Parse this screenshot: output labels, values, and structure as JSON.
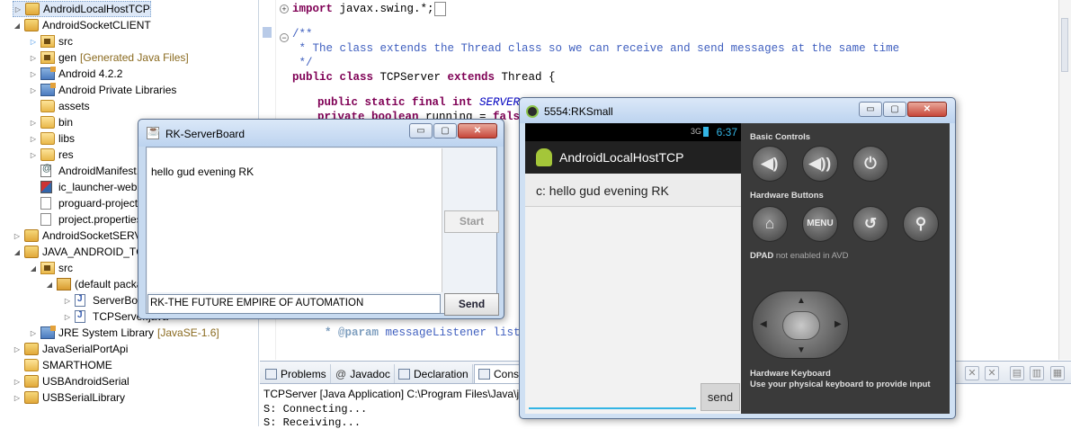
{
  "explorer": {
    "rows": [
      {
        "label": "AndroidLocalHostTCP",
        "decor": ""
      },
      {
        "label": "AndroidSocketCLIENT",
        "decor": ""
      },
      {
        "label": "src",
        "decor": ""
      },
      {
        "label": "gen",
        "decor": "[Generated Java Files]"
      },
      {
        "label": "Android 4.2.2",
        "decor": ""
      },
      {
        "label": "Android Private Libraries",
        "decor": ""
      },
      {
        "label": "assets",
        "decor": ""
      },
      {
        "label": "bin",
        "decor": ""
      },
      {
        "label": "libs",
        "decor": ""
      },
      {
        "label": "res",
        "decor": ""
      },
      {
        "label": "AndroidManifest.xml",
        "decor": ""
      },
      {
        "label": "ic_launcher-web.png",
        "decor": ""
      },
      {
        "label": "proguard-project.txt",
        "decor": ""
      },
      {
        "label": "project.properties",
        "decor": ""
      },
      {
        "label": "AndroidSocketSERVER",
        "decor": ""
      },
      {
        "label": "JAVA_ANDROID_TCP",
        "decor": ""
      },
      {
        "label": "src",
        "decor": ""
      },
      {
        "label": "(default package)",
        "decor": ""
      },
      {
        "label": "ServerBoard.java",
        "decor": ""
      },
      {
        "label": "TCPServer.java",
        "decor": ""
      },
      {
        "label": "JRE System Library",
        "decor": "[JavaSE-1.6]"
      },
      {
        "label": "JavaSerialPortApi",
        "decor": ""
      },
      {
        "label": "SMARTHOME",
        "decor": ""
      },
      {
        "label": "USBAndroidSerial",
        "decor": ""
      },
      {
        "label": "USBSerialLibrary",
        "decor": ""
      }
    ]
  },
  "editor": {
    "import_kw": "import",
    "import_rest": " javax.swing.*;",
    "import_box": " ",
    "doc_open": "/**",
    "doc_line": " * The class extends the Thread class so we can receive and send messages at the same time",
    "doc_close": " */",
    "class_kw1": "public class",
    "class_name": " TCPServer ",
    "class_kw2": "extends",
    "class_rest": " Thread {",
    "field1_kw": "public static final int",
    "field1_name": " SERVERPO",
    "field2_kw": "private boolean",
    "field2_rest": " running = ",
    "field2_val": "false",
    "field2_end": ";",
    "param_tag": "* @param",
    "param_rest": " messageListener listen"
  },
  "bottom": {
    "tabs": [
      "Problems",
      "Javadoc",
      "Declaration",
      "Cons"
    ],
    "console_title": "TCPServer [Java Application] C:\\Program Files\\Java\\jre",
    "console_lines": [
      "S: Connecting...",
      "S: Receiving..."
    ]
  },
  "swing": {
    "title": "RK-ServerBoard",
    "message": "hello gud evening RK",
    "start_label": "Start",
    "input_value": "RK-THE FUTURE EMPIRE OF AUTOMATION",
    "send_label": "Send",
    "min_glyph": "▭",
    "max_glyph": "▢",
    "close_glyph": "✕"
  },
  "emulator": {
    "title": "5554:RKSmall",
    "status_signal": "3G",
    "status_time": "6:37",
    "app_title": "AndroidLocalHostTCP",
    "received_message": "c: hello gud evening RK",
    "send_label": "send",
    "basic_controls": "Basic Controls",
    "hardware_buttons": "Hardware Buttons",
    "dpad_label": "DPAD",
    "dpad_note": "not enabled in AVD",
    "keyboard_label": "Hardware Keyboard",
    "keyboard_note": "Use your physical keyboard to provide input",
    "menu_label": "MENU",
    "vol_down_glyph": "◀)",
    "vol_up_glyph": "◀))",
    "power_glyph": "⏻",
    "home_glyph": "⌂",
    "back_glyph": "↺",
    "search_glyph": "⚲"
  }
}
